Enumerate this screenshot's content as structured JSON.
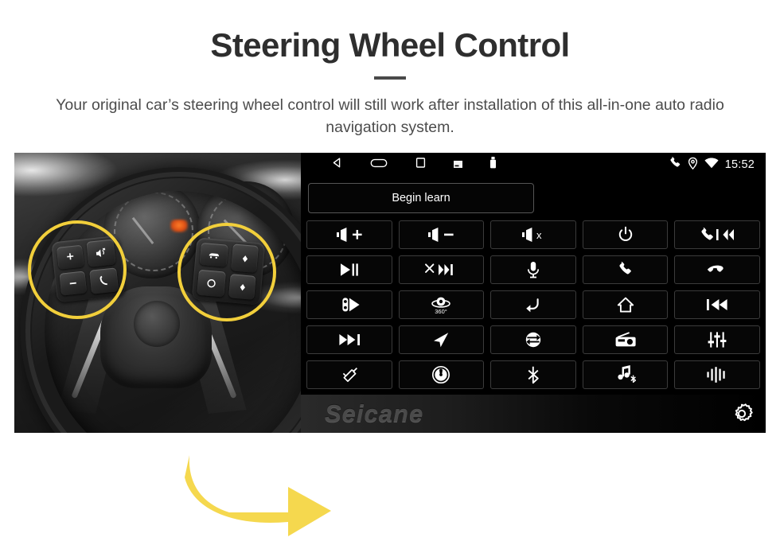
{
  "header": {
    "title": "Steering Wheel Control",
    "subtitle": "Your original car’s steering wheel control will still work after installation of this all-in-one auto radio navigation system."
  },
  "photo": {
    "alt_name": "steering-wheel-photo",
    "highlight_color": "#F2CF3B",
    "arrow_color": "#F5D84E",
    "left_pad_keys": [
      "+",
      "−",
      "mute-icon",
      "phone-icon"
    ],
    "right_pad_keys": [
      "cruise-icon",
      "diamond-up-icon",
      "circle-icon",
      "diamond-down-icon"
    ]
  },
  "head_unit": {
    "statusbar": {
      "left_icons": [
        "back-triangle-icon",
        "home-oval-icon",
        "recents-square-icon",
        "sd-card-icon",
        "usb-icon"
      ],
      "right_icons": [
        "phone-icon",
        "location-pin-icon",
        "wifi-icon"
      ],
      "time": "15:52"
    },
    "begin_learn_label": "Begin learn",
    "buttons": [
      {
        "name": "volume-up",
        "icon": "speaker-plus-icon"
      },
      {
        "name": "volume-down",
        "icon": "speaker-minus-icon"
      },
      {
        "name": "mute",
        "icon": "speaker-x-icon"
      },
      {
        "name": "power",
        "icon": "power-icon"
      },
      {
        "name": "call-previous",
        "icon": "phone-rewind-icon"
      },
      {
        "name": "play-pause",
        "icon": "play-pause-icon"
      },
      {
        "name": "hangup-next",
        "icon": "hangup-next-icon"
      },
      {
        "name": "voice-microphone",
        "icon": "microphone-icon"
      },
      {
        "name": "answer-call",
        "icon": "phone-icon"
      },
      {
        "name": "end-call",
        "icon": "phone-hangup-icon"
      },
      {
        "name": "parking-sensor",
        "icon": "car-radar-icon"
      },
      {
        "name": "camera-360",
        "icon": "camera-360-icon"
      },
      {
        "name": "back",
        "icon": "back-arrow-icon"
      },
      {
        "name": "home",
        "icon": "home-icon"
      },
      {
        "name": "previous-track",
        "icon": "previous-track-icon"
      },
      {
        "name": "next-track",
        "icon": "next-track-icon"
      },
      {
        "name": "navigation",
        "icon": "navigation-arrow-icon"
      },
      {
        "name": "source-switch",
        "icon": "swap-circle-icon"
      },
      {
        "name": "radio",
        "icon": "radio-icon"
      },
      {
        "name": "equalizer",
        "icon": "equalizer-icon"
      },
      {
        "name": "aux-input",
        "icon": "aux-cable-icon"
      },
      {
        "name": "disc",
        "icon": "disc-icon"
      },
      {
        "name": "bluetooth",
        "icon": "bluetooth-icon"
      },
      {
        "name": "bluetooth-music",
        "icon": "bluetooth-music-icon"
      },
      {
        "name": "sound-wave",
        "icon": "sound-wave-icon"
      }
    ],
    "camera_360_label": "360°",
    "brand": "Seicane",
    "settings_icon": "gear-icon"
  }
}
